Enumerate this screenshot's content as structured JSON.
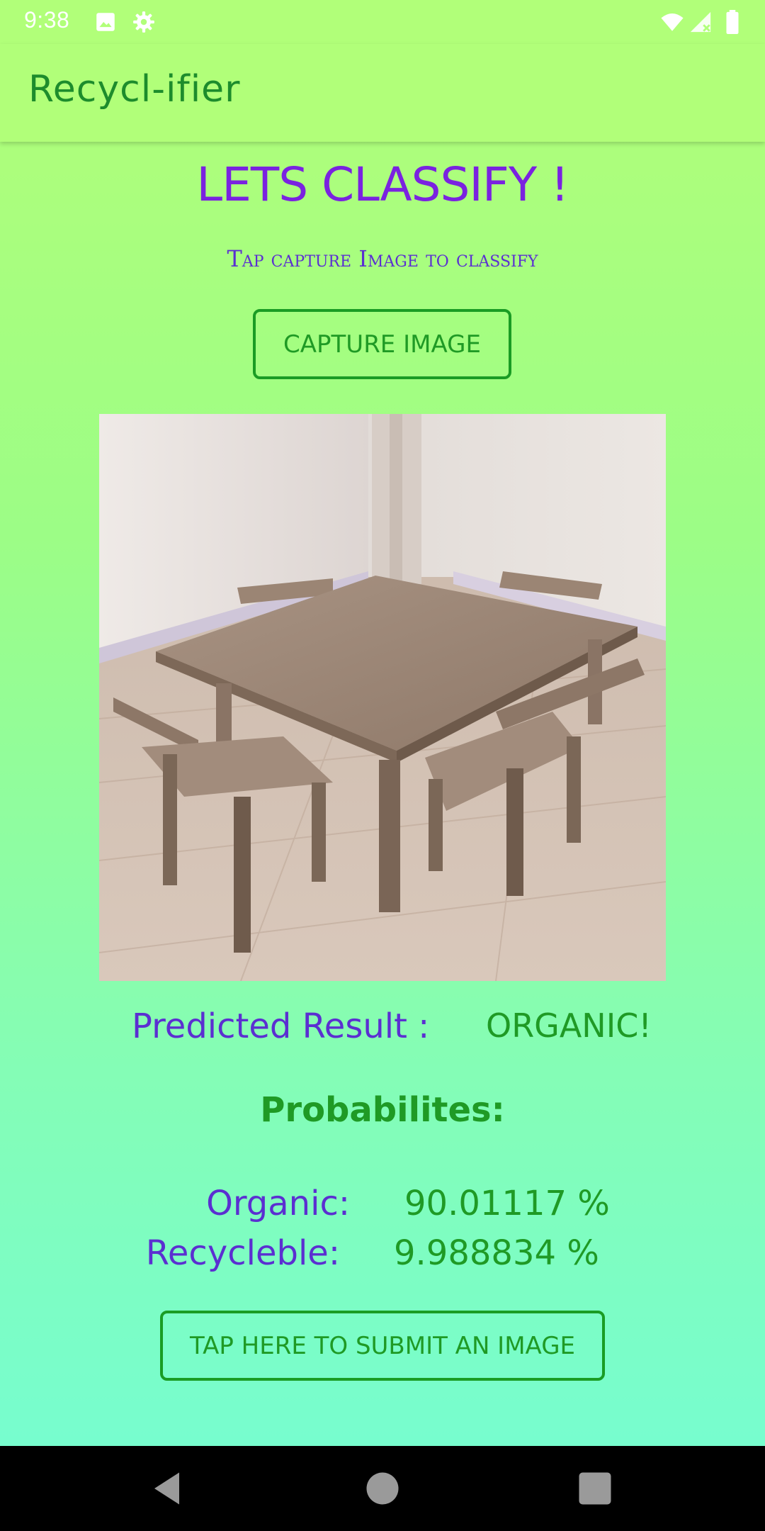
{
  "status_bar": {
    "time": "9:38",
    "icons": [
      "image-icon",
      "gear-icon",
      "wifi-icon",
      "signal-icon",
      "battery-icon"
    ]
  },
  "app_bar": {
    "title": "Recycl-ifier"
  },
  "main": {
    "heading": "LETS CLASSIFY !",
    "subheading": "Tap capture Image to classify",
    "capture_button_label": "CAPTURE IMAGE",
    "predicted_label": "Predicted Result :",
    "predicted_value": "ORGANIC!",
    "probabilities_heading": "Probabilites:",
    "organic_label": "Organic:",
    "organic_value": "90.01117 %",
    "recycleble_label": "Recycleble:",
    "recycleble_value": "9.988834 %",
    "submit_button_label": "TAP HERE TO SUBMIT AN IMAGE"
  },
  "nav_bar": {
    "icons": [
      "back-icon",
      "home-icon",
      "recents-icon"
    ]
  },
  "colors": {
    "accent_green": "#1f9a25",
    "accent_purple": "#7a22e0",
    "app_bar_bg": "#b1ff79"
  }
}
